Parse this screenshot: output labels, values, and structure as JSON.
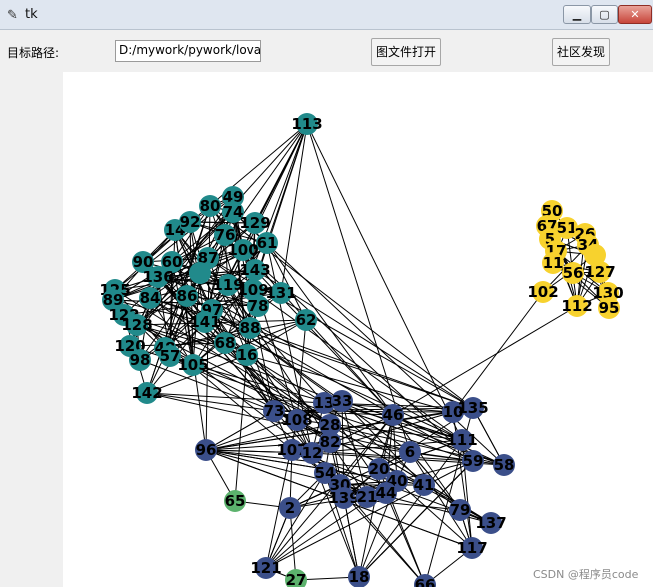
{
  "window": {
    "title": "tk",
    "feather_icon": "feather-icon",
    "min_icon": "minimize-icon",
    "max_icon": "maximize-icon",
    "close_icon": "close-icon"
  },
  "toolbar": {
    "path_label": "目标路径:",
    "path_value": "D:/mywork/pywork/lova",
    "open_button": "图文件打开",
    "community_button": "社区发现"
  },
  "colors": {
    "teal": "#218a8b",
    "blue": "#3b4f8a",
    "yellow": "#f7d22e",
    "green": "#5cb26d"
  },
  "watermark": "CSDN @程序员code",
  "graph": {
    "nodes": [
      {
        "id": "113",
        "c": "teal"
      },
      {
        "id": "49",
        "c": "teal"
      },
      {
        "id": "80",
        "c": "teal"
      },
      {
        "id": "74",
        "c": "teal"
      },
      {
        "id": "129",
        "c": "teal"
      },
      {
        "id": "14",
        "c": "teal"
      },
      {
        "id": "92",
        "c": "teal"
      },
      {
        "id": "76",
        "c": "teal"
      },
      {
        "id": "61",
        "c": "teal"
      },
      {
        "id": "90",
        "c": "teal"
      },
      {
        "id": "60",
        "c": "teal"
      },
      {
        "id": "87",
        "c": "teal"
      },
      {
        "id": "136",
        "c": "teal"
      },
      {
        "id": "65a",
        "label": "",
        "c": "teal"
      },
      {
        "id": "100",
        "c": "teal"
      },
      {
        "id": "143",
        "c": "teal"
      },
      {
        "id": "125",
        "c": "teal"
      },
      {
        "id": "89",
        "c": "teal"
      },
      {
        "id": "84",
        "c": "teal"
      },
      {
        "id": "86",
        "c": "teal"
      },
      {
        "id": "119",
        "c": "teal"
      },
      {
        "id": "109",
        "c": "teal"
      },
      {
        "id": "131",
        "c": "teal"
      },
      {
        "id": "122",
        "c": "teal"
      },
      {
        "id": "78",
        "c": "teal"
      },
      {
        "id": "128",
        "c": "teal"
      },
      {
        "id": "97",
        "c": "teal"
      },
      {
        "id": "62",
        "c": "teal"
      },
      {
        "id": "141",
        "c": "teal"
      },
      {
        "id": "88",
        "c": "teal"
      },
      {
        "id": "120",
        "c": "teal"
      },
      {
        "id": "48",
        "c": "teal"
      },
      {
        "id": "68",
        "c": "teal"
      },
      {
        "id": "16",
        "c": "teal"
      },
      {
        "id": "98",
        "c": "teal"
      },
      {
        "id": "57",
        "c": "teal"
      },
      {
        "id": "105",
        "c": "teal"
      },
      {
        "id": "142",
        "c": "teal"
      },
      {
        "id": "50",
        "c": "yellow"
      },
      {
        "id": "67",
        "c": "yellow"
      },
      {
        "id": "51",
        "c": "yellow"
      },
      {
        "id": "26",
        "c": "yellow"
      },
      {
        "id": "5",
        "c": "yellow"
      },
      {
        "id": "34",
        "c": "yellow"
      },
      {
        "id": "17",
        "c": "yellow"
      },
      {
        "id": "18b",
        "label": "",
        "c": "yellow"
      },
      {
        "id": "11",
        "c": "yellow"
      },
      {
        "id": "56",
        "c": "yellow"
      },
      {
        "id": "127",
        "c": "yellow"
      },
      {
        "id": "102",
        "c": "yellow"
      },
      {
        "id": "130",
        "c": "yellow"
      },
      {
        "id": "112",
        "c": "yellow"
      },
      {
        "id": "95",
        "c": "yellow"
      },
      {
        "id": "73",
        "c": "blue"
      },
      {
        "id": "108",
        "c": "blue"
      },
      {
        "id": "13",
        "c": "blue"
      },
      {
        "id": "33",
        "c": "blue"
      },
      {
        "id": "46",
        "c": "blue"
      },
      {
        "id": "10",
        "c": "blue"
      },
      {
        "id": "135",
        "c": "blue"
      },
      {
        "id": "28",
        "c": "blue"
      },
      {
        "id": "82",
        "c": "blue"
      },
      {
        "id": "111",
        "c": "blue"
      },
      {
        "id": "96",
        "c": "blue"
      },
      {
        "id": "107",
        "c": "blue"
      },
      {
        "id": "12",
        "c": "blue"
      },
      {
        "id": "6",
        "c": "blue"
      },
      {
        "id": "59",
        "c": "blue"
      },
      {
        "id": "58",
        "c": "blue"
      },
      {
        "id": "54",
        "c": "blue"
      },
      {
        "id": "20",
        "c": "blue"
      },
      {
        "id": "30",
        "c": "blue"
      },
      {
        "id": "40",
        "c": "blue"
      },
      {
        "id": "41",
        "c": "blue"
      },
      {
        "id": "139",
        "c": "blue"
      },
      {
        "id": "21",
        "c": "blue"
      },
      {
        "id": "44",
        "c": "blue"
      },
      {
        "id": "2",
        "c": "blue"
      },
      {
        "id": "79",
        "c": "blue"
      },
      {
        "id": "137",
        "c": "blue"
      },
      {
        "id": "117",
        "c": "blue"
      },
      {
        "id": "121",
        "c": "blue"
      },
      {
        "id": "18",
        "c": "blue"
      },
      {
        "id": "66",
        "c": "blue"
      },
      {
        "id": "65",
        "c": "green"
      },
      {
        "id": "27",
        "c": "green"
      }
    ]
  }
}
